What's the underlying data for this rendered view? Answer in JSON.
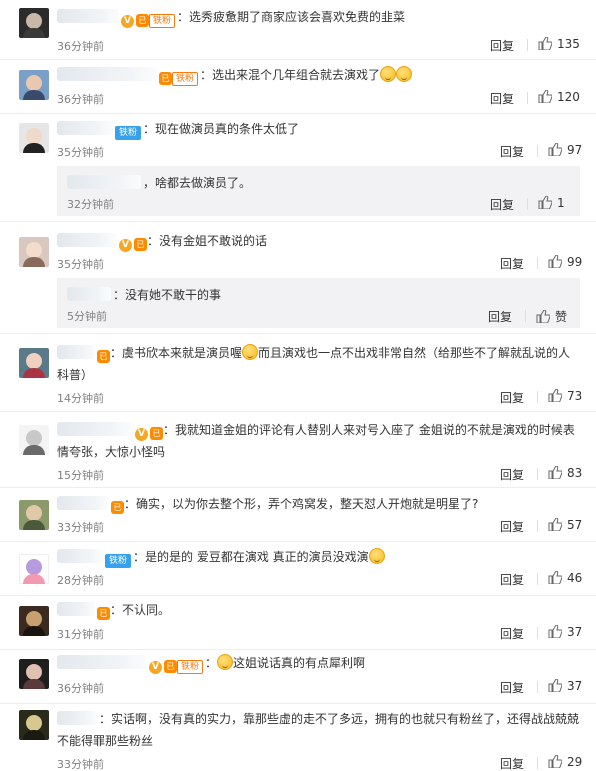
{
  "reply_label": "回复",
  "badges": {
    "fan": "铁粉",
    "v": "V",
    "lv": "已"
  },
  "comments": [
    {
      "text": "选秀疲惫期了商家应该会喜欢免费的韭菜",
      "time": "36分钟前",
      "likes": "135",
      "avatar": [
        "#2b2b2b",
        "#c9b8a8",
        "#3a3a3a"
      ]
    },
    {
      "text": "选出来混个几年组合就去演戏了",
      "time": "36分钟前",
      "likes": "120",
      "avatar": [
        "#7aa0c8",
        "#e8c8b0",
        "#3a4a6a"
      ]
    },
    {
      "text": "现在做演员真的条件太低了",
      "time": "35分钟前",
      "likes": "97",
      "avatar": [
        "#e6e6e6",
        "#f0d9c8",
        "#222222"
      ]
    },
    {
      "text": "啥都去做演员了。",
      "time": "32分钟前",
      "likes": "1"
    },
    {
      "text": "没有金姐不敢说的话",
      "time": "35分钟前",
      "likes": "99",
      "avatar": [
        "#d8c8c0",
        "#f3dccc",
        "#8a6a5a"
      ]
    },
    {
      "text": "没有她不敢干的事",
      "time": "5分钟前",
      "likes": "赞"
    },
    {
      "text": "虞书欣本来就是演员喔",
      "text2": "而且演戏也一点不出戏非常自然（给那些不了解就乱说的人科普）",
      "time": "14分钟前",
      "likes": "73",
      "avatar": [
        "#5a7a8a",
        "#f0d0c0",
        "#aa3344"
      ]
    },
    {
      "text": "我就知道金姐的评论有人替别人来对号入座了 金姐说的不就是演戏的时候表情夸张，大惊小怪吗",
      "time": "15分钟前",
      "likes": "83",
      "avatar": [
        "#f4f4f4",
        "#c8c8c8",
        "#6a6a6a"
      ]
    },
    {
      "text": "确实，以为你去整个形，弄个鸡窝发，整天怼人开炮就是明星了?",
      "time": "33分钟前",
      "likes": "57",
      "avatar": [
        "#8a9a6a",
        "#e0c8a8",
        "#4a5a3a"
      ]
    },
    {
      "text": "是的是的 爱豆都在演戏 真正的演员没戏演",
      "time": "28分钟前",
      "likes": "46",
      "avatar": [
        "#ffffff",
        "#b89adf",
        "#f29bb0"
      ]
    },
    {
      "text": "不认同。",
      "time": "31分钟前",
      "likes": "37",
      "avatar": [
        "#3a2a20",
        "#c8a070",
        "#1a1410"
      ]
    },
    {
      "text": "这姐说话真的有点犀利啊",
      "time": "36分钟前",
      "likes": "37",
      "avatar": [
        "#1e1e1e",
        "#e0c0b0",
        "#5a3a3a"
      ]
    },
    {
      "text": "实话啊，没有真的实力，靠那些虚的走不了多远，拥有的也就只有粉丝了，还得战战兢兢不能得罪那些粉丝",
      "time": "33分钟前",
      "likes": "29",
      "avatar": [
        "#2a2a1a",
        "#d8c890",
        "#1a1a10"
      ]
    }
  ]
}
